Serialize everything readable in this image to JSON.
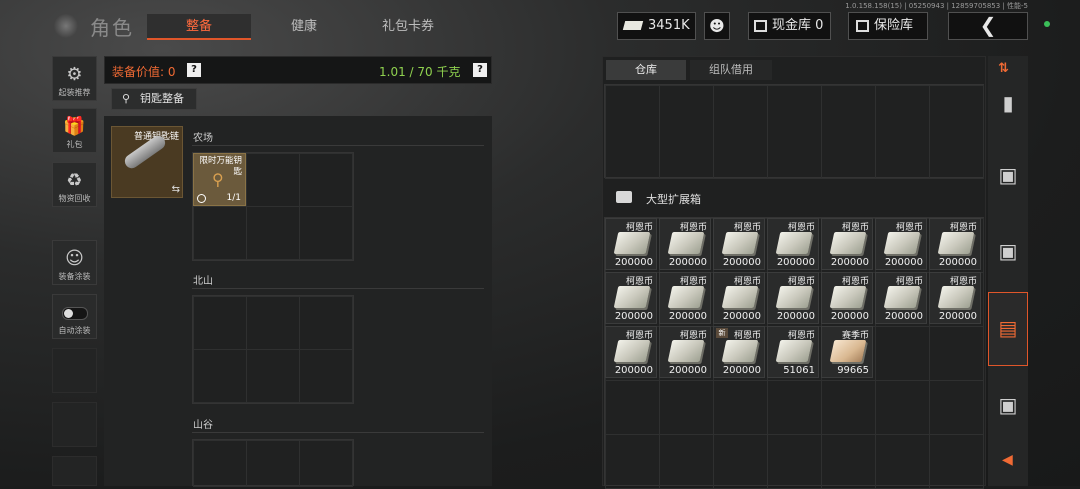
{
  "header": {
    "title": "角色",
    "tabs": [
      {
        "label": "整备",
        "active": true
      },
      {
        "label": "健康",
        "active": false
      },
      {
        "label": "礼包卡券",
        "active": false
      }
    ],
    "money": "3451K",
    "cash_vault": "现金库 0",
    "safe_vault": "保险库",
    "version": "1.0.158.158(15) | 05250943 | 12859705853 | 性能-5"
  },
  "left_menu": [
    {
      "label": "起装推荐",
      "icon": "helmet-gear-icon"
    },
    {
      "label": "礼包",
      "icon": "gift-icon"
    },
    {
      "label": "物资回收",
      "icon": "recycle-icon"
    },
    {
      "label": "装备涂装",
      "icon": "paint-mask-icon"
    },
    {
      "label": "自动涂装",
      "icon": "toggle-icon"
    }
  ],
  "equipment": {
    "value_label": "装备价值: 0",
    "weight": "1.01 / 70 千克",
    "key_button": "钥匙整备",
    "keychain_name": "普通钥匙链",
    "sections": [
      "农场",
      "北山",
      "山谷"
    ],
    "key_item": {
      "name": "限时万能钥匙",
      "count": "1/1"
    }
  },
  "storage": {
    "tabs": [
      "仓库",
      "组队借用"
    ],
    "container_title": "大型扩展箱",
    "items": [
      {
        "name": "柯恩币",
        "amount": "200000",
        "type": "cash"
      },
      {
        "name": "柯恩币",
        "amount": "200000",
        "type": "cash"
      },
      {
        "name": "柯恩币",
        "amount": "200000",
        "type": "cash"
      },
      {
        "name": "柯恩币",
        "amount": "200000",
        "type": "cash"
      },
      {
        "name": "柯恩币",
        "amount": "200000",
        "type": "cash"
      },
      {
        "name": "柯恩币",
        "amount": "200000",
        "type": "cash"
      },
      {
        "name": "柯恩币",
        "amount": "200000",
        "type": "cash"
      },
      {
        "name": "柯恩币",
        "amount": "200000",
        "type": "cash"
      },
      {
        "name": "柯恩币",
        "amount": "200000",
        "type": "cash"
      },
      {
        "name": "柯恩币",
        "amount": "200000",
        "type": "cash"
      },
      {
        "name": "柯恩币",
        "amount": "200000",
        "type": "cash"
      },
      {
        "name": "柯恩币",
        "amount": "200000",
        "type": "cash"
      },
      {
        "name": "柯恩币",
        "amount": "200000",
        "type": "cash"
      },
      {
        "name": "柯恩币",
        "amount": "200000",
        "type": "cash"
      },
      {
        "name": "柯恩币",
        "amount": "200000",
        "type": "cash"
      },
      {
        "name": "柯恩币",
        "amount": "200000",
        "type": "cash"
      },
      {
        "name": "柯恩币",
        "amount": "200000",
        "type": "cash",
        "new": "新"
      },
      {
        "name": "柯恩币",
        "amount": "51061",
        "type": "cash"
      },
      {
        "name": "赛季币",
        "amount": "99665",
        "type": "season"
      }
    ]
  },
  "colors": {
    "accent": "#f06a34",
    "weight_green": "#8fd14f"
  }
}
